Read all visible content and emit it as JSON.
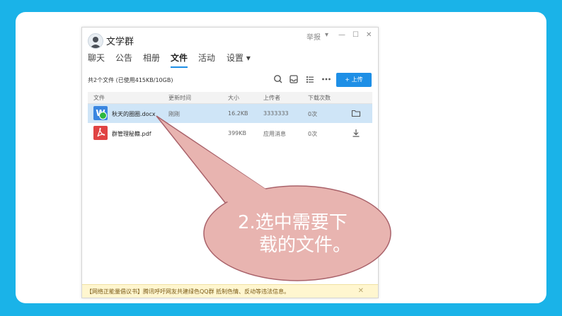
{
  "window": {
    "title": "文学群",
    "report_label": "举报",
    "dropdown_glyph": "▾",
    "minimize_glyph": "—",
    "maximize_glyph": "☐",
    "close_glyph": "✕"
  },
  "tabs": [
    {
      "label": "聊天"
    },
    {
      "label": "公告"
    },
    {
      "label": "相册"
    },
    {
      "label": "文件",
      "active": true
    },
    {
      "label": "活动"
    },
    {
      "label": "设置 ▾"
    }
  ],
  "toolbar": {
    "summary": "共2个文件 (已使用415KB/10GB)",
    "upload_label": "+ 上传",
    "icons": [
      "search-icon",
      "inbox-icon",
      "list-icon",
      "more-icon"
    ]
  },
  "table": {
    "headers": [
      "文件",
      "更新时间",
      "大小",
      "上传者",
      "下载次数"
    ],
    "rows": [
      {
        "name": "秋天的圈圈.docx",
        "updated": "刚刚",
        "size": "16.2KB",
        "uploader": "3333333",
        "downloads": "0次",
        "type": "word",
        "icon_letter": "W",
        "action": "folder-icon",
        "selected": true
      },
      {
        "name": "群管理秘籍.pdf",
        "updated": "",
        "size": "399KB",
        "uploader": "应用消息",
        "downloads": "0次",
        "type": "pdf",
        "action": "download-icon",
        "selected": false
      }
    ]
  },
  "notice": {
    "text": "【网络正能量倡议书】腾讯呼吁网友共建绿色QQ群 抵制色情、反动等违法信息。",
    "close_glyph": "✕"
  },
  "callout": {
    "line1": "2.选中需要下",
    "line2": "载的文件。",
    "fill": "#e8b4b0",
    "stroke": "#a9626a"
  }
}
